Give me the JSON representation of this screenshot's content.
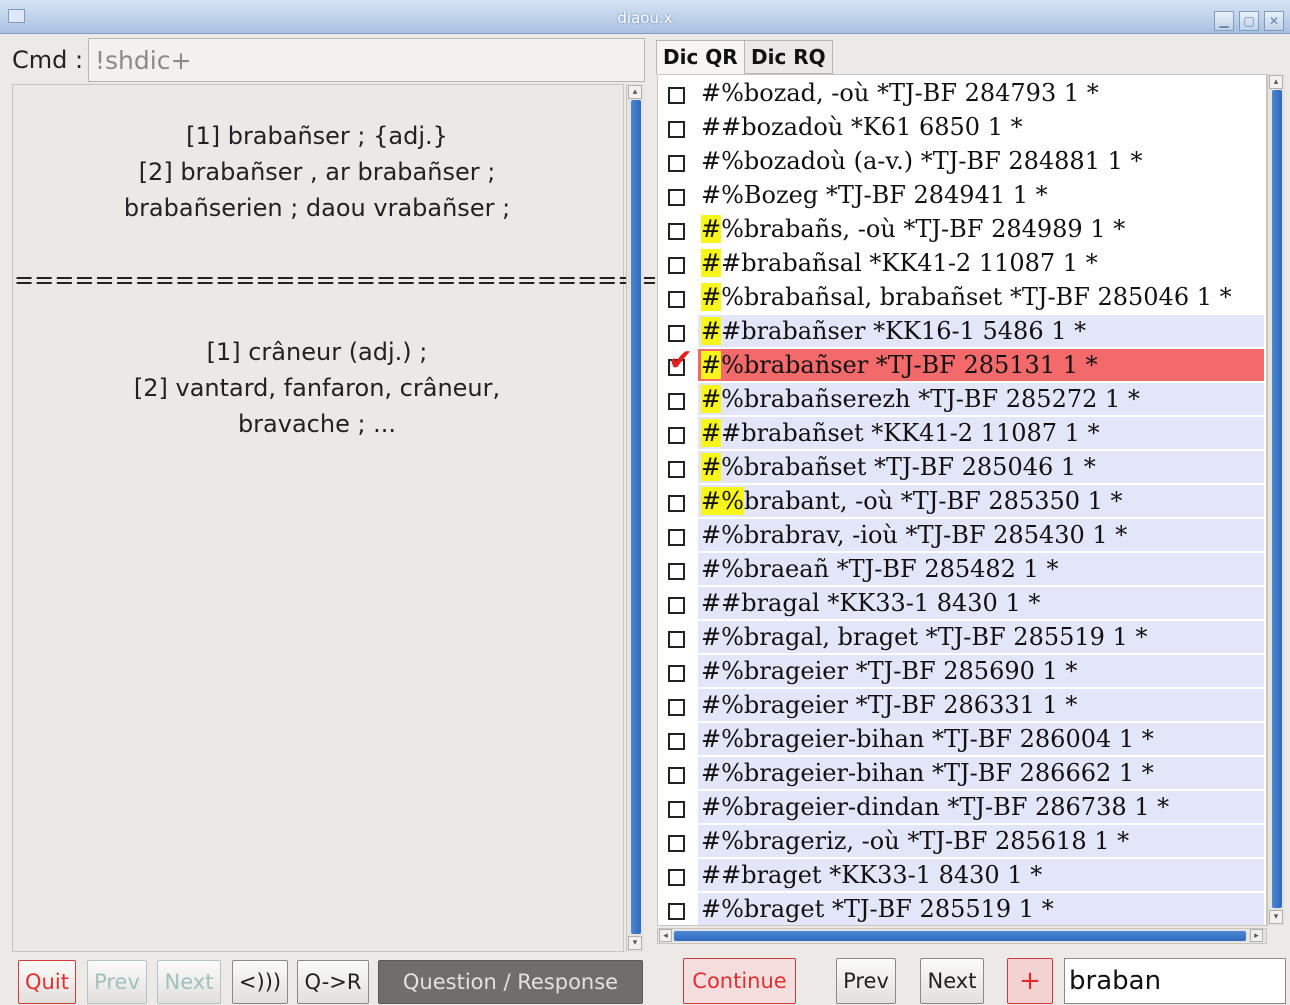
{
  "window": {
    "title": "diaou.x"
  },
  "cmd": {
    "label": "Cmd :",
    "value": "!shdic+"
  },
  "left_content": {
    "lines": [
      "[1] brabañser ; {adj.}",
      "[2] brabañser , ar brabañser ;",
      "brabañserien ; daou vrabañser ;",
      "",
      "================================",
      "",
      "[1] crâneur (adj.) ;",
      "[2] vantard, fanfaron, crâneur,",
      "bravache ; ..."
    ]
  },
  "left_buttons": {
    "quit": "Quit",
    "prev": "Prev",
    "next": "Next",
    "audio": "<)))",
    "qr": "Q->R",
    "question_response": "Question / Response"
  },
  "tabs": [
    "Dic QR",
    "Dic RQ"
  ],
  "list": {
    "rows": [
      {
        "prefix": "#%",
        "text": "bozad, -où *TJ-BF 284793  1 *",
        "checked": false,
        "highlight": 0,
        "bg": "white"
      },
      {
        "prefix": "##",
        "text": "bozadoù *K61 6850 1 *",
        "checked": false,
        "highlight": 0,
        "bg": "white"
      },
      {
        "prefix": "#%",
        "text": "bozadoù (a-v.) *TJ-BF 284881  1 *",
        "checked": false,
        "highlight": 0,
        "bg": "white"
      },
      {
        "prefix": "#%",
        "text": "Bozeg *TJ-BF 284941  1 *",
        "checked": false,
        "highlight": 0,
        "bg": "white"
      },
      {
        "prefix": "#%",
        "text": "brabañs, -où *TJ-BF 284989  1 *",
        "checked": false,
        "highlight": 1,
        "bg": "white"
      },
      {
        "prefix": "##",
        "text": "brabañsal *KK41-2 11087 1 *",
        "checked": false,
        "highlight": 1,
        "bg": "white"
      },
      {
        "prefix": "#%",
        "text": "brabañsal, brabañset *TJ-BF 285046  1 *",
        "checked": false,
        "highlight": 1,
        "bg": "white"
      },
      {
        "prefix": "##",
        "text": "brabañser *KK16-1 5486 1 *",
        "checked": false,
        "highlight": 1,
        "bg": "blue"
      },
      {
        "prefix": "#%",
        "text": "brabañser *TJ-BF 285131  1 *",
        "checked": true,
        "highlight": 1,
        "bg": "selected"
      },
      {
        "prefix": "#%",
        "text": "brabañserezh *TJ-BF 285272  1 *",
        "checked": false,
        "highlight": 1,
        "bg": "blue"
      },
      {
        "prefix": "##",
        "text": "brabañset *KK41-2 11087 1 *",
        "checked": false,
        "highlight": 1,
        "bg": "blue"
      },
      {
        "prefix": "#%",
        "text": "brabañset *TJ-BF 285046  1 *",
        "checked": false,
        "highlight": 1,
        "bg": "blue"
      },
      {
        "prefix": "#%",
        "text": "brabant, -où *TJ-BF 285350  1 *",
        "checked": false,
        "highlight": 2,
        "bg": "blue"
      },
      {
        "prefix": "#%",
        "text": "brabrav, -ioù *TJ-BF 285430  1 *",
        "checked": false,
        "highlight": 0,
        "bg": "blue"
      },
      {
        "prefix": "#%",
        "text": "braeañ *TJ-BF 285482  1 *",
        "checked": false,
        "highlight": 0,
        "bg": "blue"
      },
      {
        "prefix": "##",
        "text": "bragal *KK33-1 8430 1 *",
        "checked": false,
        "highlight": 0,
        "bg": "blue"
      },
      {
        "prefix": "#%",
        "text": "bragal, braget *TJ-BF 285519  1 *",
        "checked": false,
        "highlight": 0,
        "bg": "blue"
      },
      {
        "prefix": "#%",
        "text": "brageier *TJ-BF 285690  1 *",
        "checked": false,
        "highlight": 0,
        "bg": "blue"
      },
      {
        "prefix": "#%",
        "text": "brageier *TJ-BF 286331  1 *",
        "checked": false,
        "highlight": 0,
        "bg": "blue"
      },
      {
        "prefix": "#%",
        "text": "brageier-bihan *TJ-BF 286004  1 *",
        "checked": false,
        "highlight": 0,
        "bg": "blue"
      },
      {
        "prefix": "#%",
        "text": "brageier-bihan *TJ-BF 286662  1 *",
        "checked": false,
        "highlight": 0,
        "bg": "blue"
      },
      {
        "prefix": "#%",
        "text": "brageier-dindan *TJ-BF 286738  1 *",
        "checked": false,
        "highlight": 0,
        "bg": "blue"
      },
      {
        "prefix": "#%",
        "text": "brageriz, -où *TJ-BF 285618  1 *",
        "checked": false,
        "highlight": 0,
        "bg": "blue"
      },
      {
        "prefix": "##",
        "text": "braget *KK33-1 8430 1 *",
        "checked": false,
        "highlight": 0,
        "bg": "blue"
      },
      {
        "prefix": "#%",
        "text": "braget *TJ-BF 285519  1 *",
        "checked": false,
        "highlight": 0,
        "bg": "blue"
      }
    ]
  },
  "right_buttons": {
    "continue": "Continue",
    "prev": "Prev",
    "next": "Next",
    "plus": "+"
  },
  "search": {
    "value": "braban"
  },
  "icons": {
    "app": "window-icon",
    "minimize": "minimize-icon",
    "maximize": "maximize-icon",
    "close": "close-icon",
    "check": "checkmark-icon"
  }
}
